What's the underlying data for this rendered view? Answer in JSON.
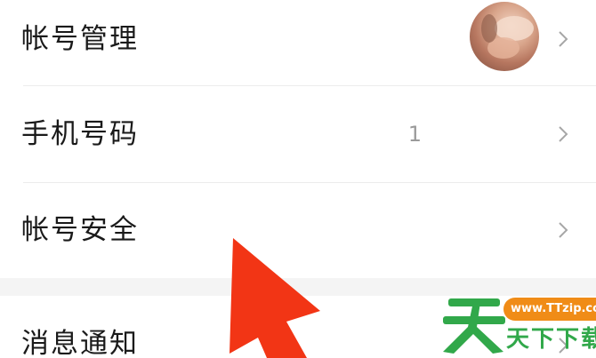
{
  "settings": {
    "items": [
      {
        "label": "帐号管理",
        "value": ""
      },
      {
        "label": "手机号码",
        "value": "1"
      },
      {
        "label": "帐号安全",
        "value": ""
      },
      {
        "label": "消息通知",
        "value": ""
      }
    ]
  },
  "icons": {
    "chevron": "chevron-right-icon",
    "annotation": "red-arrow-icon"
  },
  "colors": {
    "annotation_red": "#f23515",
    "watermark_green": "#31a84a",
    "watermark_orange": "#f08c17"
  },
  "watermark": {
    "big_char": "天",
    "url": "www.TTzip.com",
    "text": "天下下载"
  }
}
